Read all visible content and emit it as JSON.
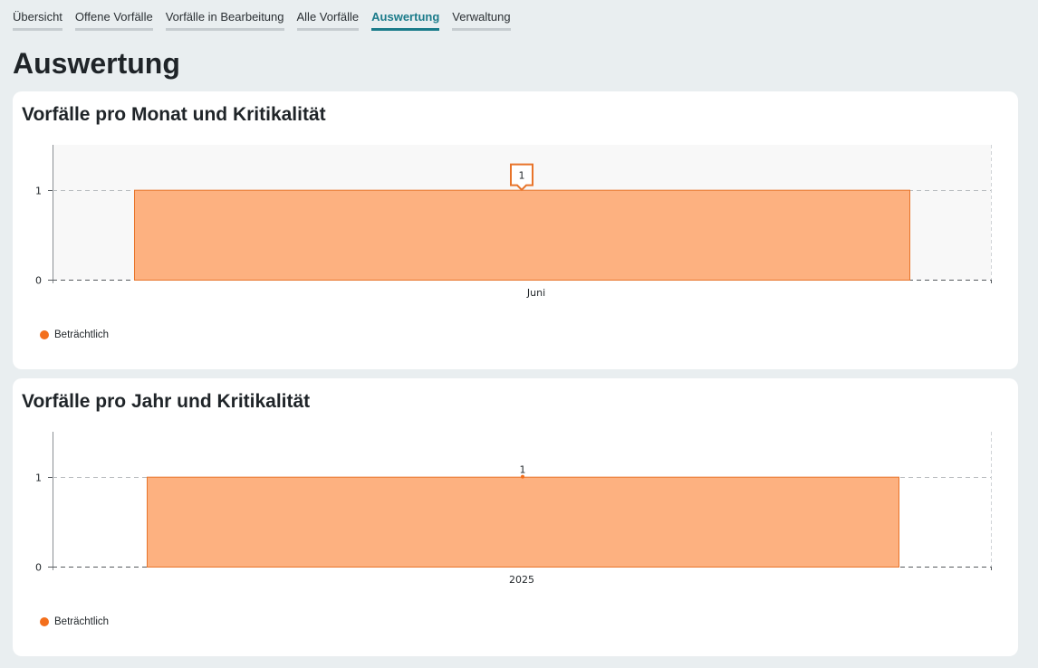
{
  "nav": {
    "tabs": [
      {
        "label": "Übersicht",
        "active": false
      },
      {
        "label": "Offene Vorfälle",
        "active": false
      },
      {
        "label": "Vorfälle in Bearbeitung",
        "active": false
      },
      {
        "label": "Alle Vorfälle",
        "active": false
      },
      {
        "label": "Auswertung",
        "active": true
      },
      {
        "label": "Verwaltung",
        "active": false
      }
    ]
  },
  "page": {
    "title": "Auswertung"
  },
  "colors": {
    "accent": "#1b7b8a",
    "bar_fill": "#fdb180",
    "bar_stroke": "#e8742a",
    "legend_dot": "#f36f1c"
  },
  "charts": [
    {
      "title": "Vorfälle pro Monat und Kritikalität",
      "legend": "Beträchtlich"
    },
    {
      "title": "Vorfälle pro Jahr und Kritikalität",
      "legend": "Beträchtlich"
    }
  ],
  "chart_data": [
    {
      "type": "bar",
      "title": "Vorfälle pro Monat und Kritikalität",
      "categories": [
        "Juni"
      ],
      "series": [
        {
          "name": "Beträchtlich",
          "values": [
            1
          ]
        }
      ],
      "ylim": [
        0,
        1.5
      ],
      "yticks": [
        0,
        1
      ],
      "data_labels": [
        "1"
      ],
      "tooltip_shown": true,
      "grid": true,
      "legend": "bottom-left"
    },
    {
      "type": "bar",
      "title": "Vorfälle pro Jahr und Kritikalität",
      "categories": [
        "2025"
      ],
      "series": [
        {
          "name": "Beträchtlich",
          "values": [
            1
          ]
        }
      ],
      "ylim": [
        0,
        1.5
      ],
      "yticks": [
        0,
        1
      ],
      "data_labels": [
        "1"
      ],
      "tooltip_shown": false,
      "grid": true,
      "legend": "bottom-left"
    }
  ]
}
